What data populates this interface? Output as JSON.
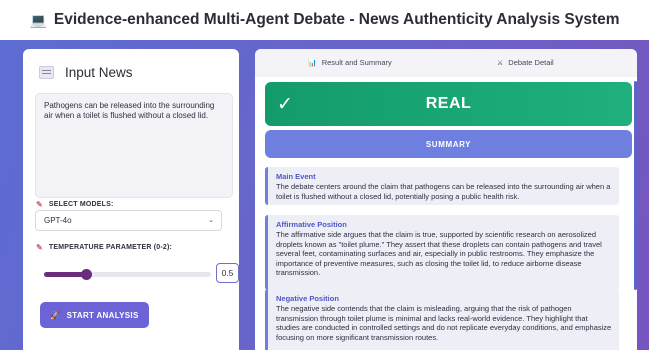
{
  "app": {
    "title": "Evidence-enhanced Multi-Agent Debate - News Authenticity Analysis System",
    "logo_icon": "computer-icon"
  },
  "left_panel": {
    "title": "Input News",
    "news_text": "Pathogens can be released into the surrounding air when a toilet is flushed without a closed lid.",
    "models_label": "SELECT MODELS:",
    "model_selected": "GPT-4o",
    "temperature_label": "TEMPERATURE PARAMETER (0-2):",
    "temperature_value": "0.5",
    "temperature_fraction": 0.25,
    "start_button": "START ANALYSIS"
  },
  "right_panel": {
    "tabs": [
      {
        "label": "Result and Summary",
        "icon": "chart-icon"
      },
      {
        "label": "Debate Detail",
        "icon": "swords-icon"
      }
    ],
    "verdict": "REAL",
    "summary_label": "SUMMARY",
    "sections": [
      {
        "heading": "Main Event",
        "body": "The debate centers around the claim that pathogens can be released into the surrounding air when a toilet is flushed without a closed lid, potentially posing a public health risk."
      },
      {
        "heading": "Affirmative Position",
        "body": "The affirmative side argues that the claim is true, supported by scientific research on aerosolized droplets known as \"toilet plume.\" They assert that these droplets can contain pathogens and travel several feet, contaminating surfaces and air, especially in public restrooms. They emphasize the importance of preventive measures, such as closing the toilet lid, to reduce airborne disease transmission."
      },
      {
        "heading": "Negative Position",
        "body": "The negative side contends that the claim is misleading, arguing that the risk of pathogen transmission through toilet plume is minimal and lacks real-world evidence. They highlight that studies are conducted in controlled settings and do not replicate everyday conditions, and emphasize focusing on more significant transmission routes."
      }
    ]
  },
  "colors": {
    "verdict_green": "#1fb07c",
    "accent": "#6c63d7",
    "summary_blue": "#6f7fe0",
    "slider": "#6b2c7e"
  }
}
